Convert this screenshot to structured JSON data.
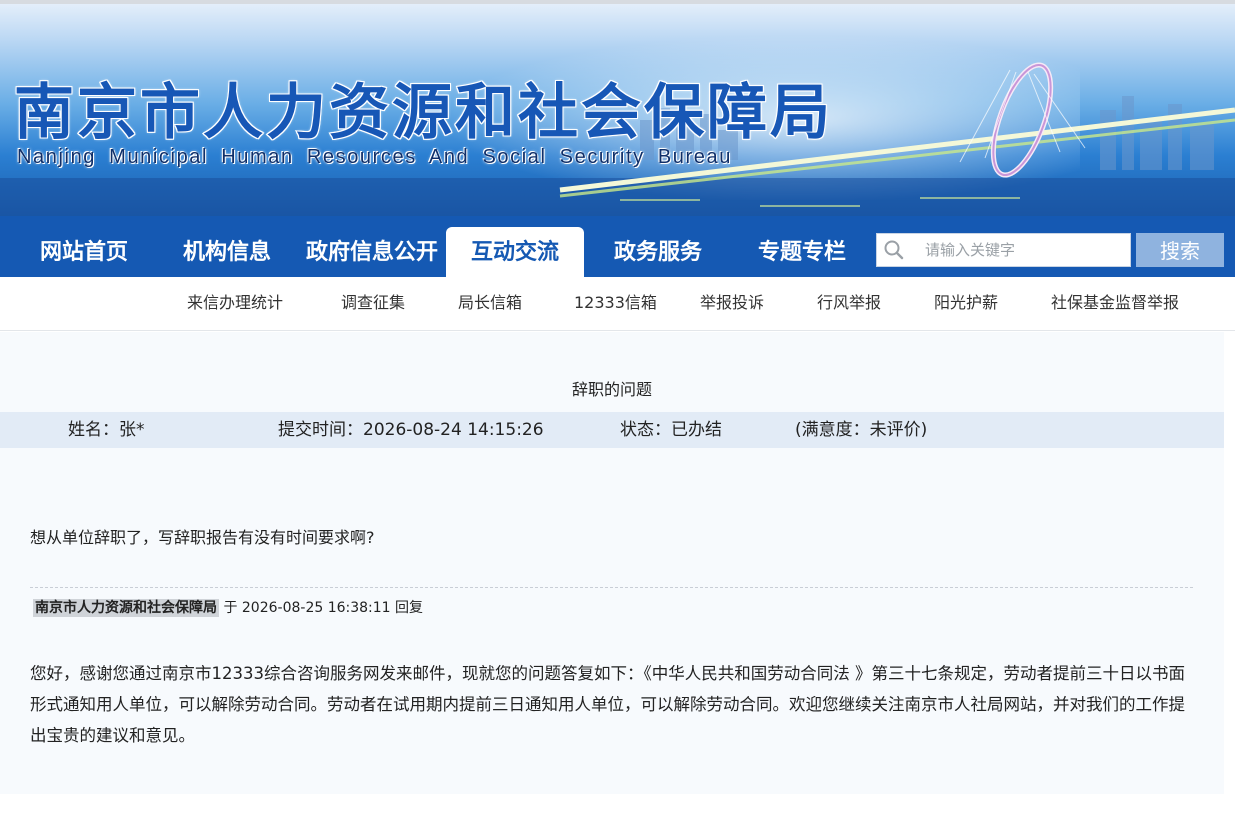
{
  "banner": {
    "title_cn": "南京市人力资源和社会保障局",
    "title_en": "Nanjing Municipal Human Resources And Social Security Bureau"
  },
  "nav": {
    "items": [
      {
        "label": "网站首页"
      },
      {
        "label": "机构信息"
      },
      {
        "label": "政府信息公开"
      },
      {
        "label": "互动交流",
        "active": true
      },
      {
        "label": "政务服务"
      },
      {
        "label": "专题专栏"
      }
    ],
    "search_placeholder": "请输入关键字",
    "search_button": "搜索"
  },
  "subnav": {
    "items": [
      {
        "label": "来信办理统计"
      },
      {
        "label": "调查征集"
      },
      {
        "label": "局长信箱"
      },
      {
        "label": "12333信箱"
      },
      {
        "label": "举报投诉"
      },
      {
        "label": "行风举报"
      },
      {
        "label": "阳光护薪"
      },
      {
        "label": "社保基金监督举报"
      }
    ]
  },
  "letter": {
    "title": "辞职的问题",
    "name": "姓名：张*",
    "submit_time": "提交时间：2026-08-24 14:15:26",
    "status": "状态：已办结",
    "satisfaction": "(满意度：未评价)",
    "question": "想从单位辞职了，写辞职报告有没有时间要求啊?",
    "reply_org": "南京市人力资源和社会保障局",
    "reply_meta": " 于 2026-08-25 16:38:11 回复",
    "answer": "您好，感谢您通过南京市12333综合咨询服务网发来邮件，现就您的问题答复如下：《中华人民共和国劳动合同法 》第三十七条规定，劳动者提前三十日以书面形式通知用人单位，可以解除劳动合同。劳动者在试用期内提前三日通知用人单位，可以解除劳动合同。欢迎您继续关注南京市人社局网站，并对我们的工作提出宝贵的建议和意见。"
  },
  "colors": {
    "nav_bg": "#1559b3",
    "active_tab_text": "#1559b3",
    "meta_bar_bg": "#e2ebf6",
    "content_bg": "#f7fafd",
    "search_button_bg": "#8fb3df"
  }
}
